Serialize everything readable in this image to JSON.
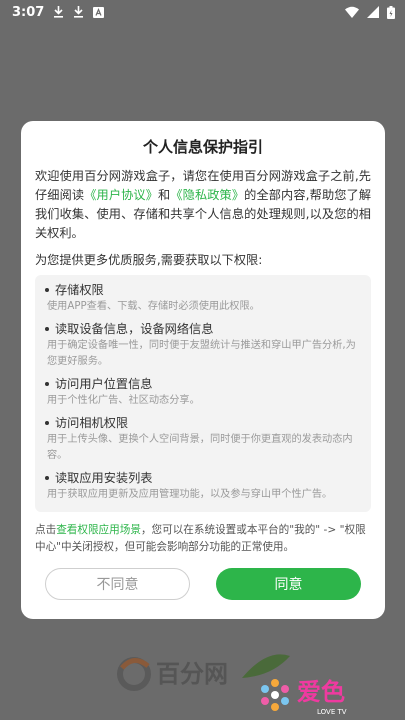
{
  "status_bar": {
    "time": "3:07"
  },
  "dialog": {
    "title": "个人信息保护指引",
    "intro_part1": "欢迎使用百分网游戏盒子，请您在使用百分网游戏盒子之前,先仔细阅读",
    "link_user_agreement": "《用户协议》",
    "and_text": "和",
    "link_privacy": "《隐私政策》",
    "intro_part2": "的全部内容,帮助您了解我们收集、使用、存储和共享个人信息的处理规则,以及您的相关权利。",
    "subhead": "为您提供更多优质服务,需要获取以下权限:",
    "permissions": [
      {
        "name": "存储权限",
        "desc": "使用APP查看、下载、存储时必须使用此权限。"
      },
      {
        "name": "读取设备信息，设备网络信息",
        "desc": "用于确定设备唯一性，同时便于友盟统计与推送和穿山甲广告分析,为您更好服务。"
      },
      {
        "name": "访问用户位置信息",
        "desc": "用于个性化广告、社区动态分享。"
      },
      {
        "name": "访问相机权限",
        "desc": "用于上传头像、更换个人空间背景，同时便于你更直观的发表动态内容。"
      },
      {
        "name": "读取应用安装列表",
        "desc": "用于获取应用更新及应用管理功能，以及参与穿山甲个性广告。"
      }
    ],
    "footer_prefix": "点击",
    "footer_link": "查看权限应用场景",
    "footer_suffix": "，您可以在系统设置或本平台的\"我的\" -> \"权限中心\"中关闭授权，但可能会影响部分功能的正常使用。",
    "disagree_label": "不同意",
    "agree_label": "同意"
  },
  "background": {
    "logo_text": "百分网"
  },
  "watermark": {
    "text": "爱色",
    "sub": "LOVE TV"
  },
  "colors": {
    "accent": "#2db54a",
    "overlay": "#6b6b6b"
  }
}
